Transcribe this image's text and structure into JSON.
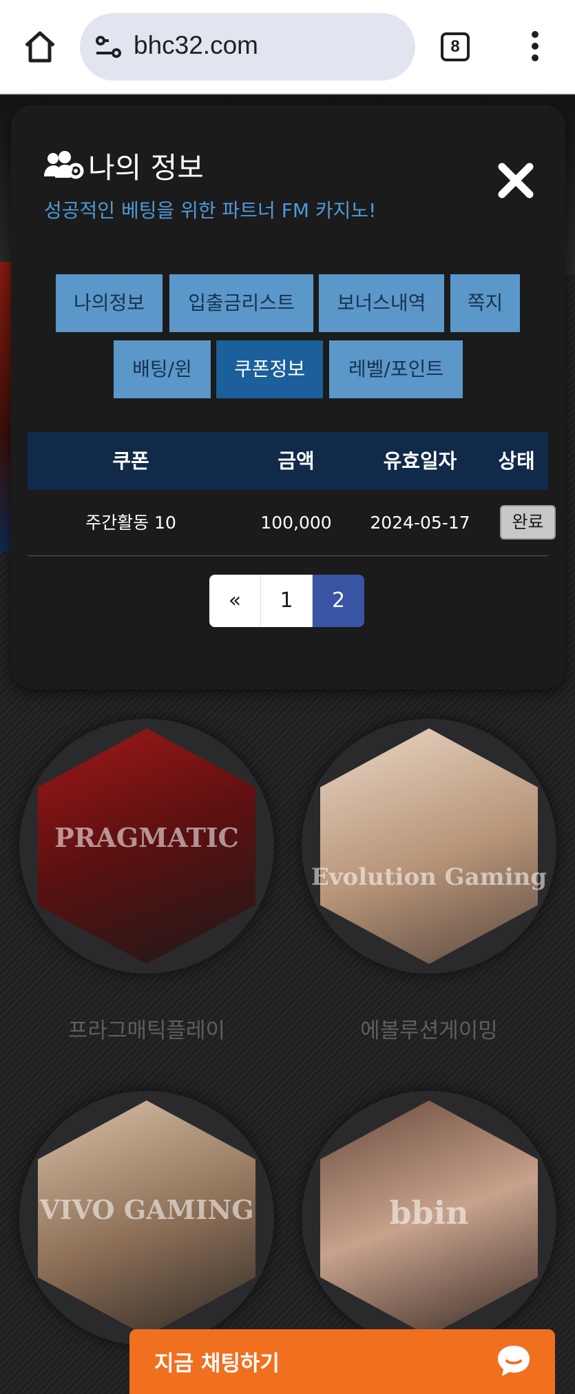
{
  "browser": {
    "url": "bhc32.com",
    "tab_count": "8"
  },
  "modal": {
    "title": "나의 정보",
    "subtitle": "성공적인 베팅을 위한 파트너 FM 카지노!",
    "tabs": [
      {
        "label": "나의정보",
        "active": false
      },
      {
        "label": "입출금리스트",
        "active": false
      },
      {
        "label": "보너스내역",
        "active": false
      },
      {
        "label": "쪽지",
        "active": false
      },
      {
        "label": "배팅/윈",
        "active": false
      },
      {
        "label": "쿠폰정보",
        "active": true
      },
      {
        "label": "레벨/포인트",
        "active": false
      }
    ],
    "table": {
      "headers": [
        "쿠폰",
        "금액",
        "유효일자",
        "상태"
      ],
      "rows": [
        {
          "coupon": "주간활동 10",
          "amount": "100,000",
          "valid_date": "2024-05-17",
          "status": "완료"
        }
      ]
    },
    "pagination": {
      "prev": "«",
      "pages": [
        "1",
        "2"
      ],
      "current": "2"
    }
  },
  "providers": [
    {
      "name": "프라그매틱플레이",
      "logo": "PRAGMATIC"
    },
    {
      "name": "에볼루션게이밍",
      "logo": "Evolution Gaming"
    },
    {
      "name": "",
      "logo": "VIVO GAMING"
    },
    {
      "name": "",
      "logo": "bbin"
    }
  ],
  "chat": {
    "label": "지금 채팅하기"
  },
  "colors": {
    "accent_blue": "#5b97c9",
    "active_tab": "#1b5f9b",
    "table_header": "#112a4a",
    "subtitle": "#4f9ad8",
    "chat_orange": "#f07020",
    "pager_active": "#3a54a4"
  }
}
